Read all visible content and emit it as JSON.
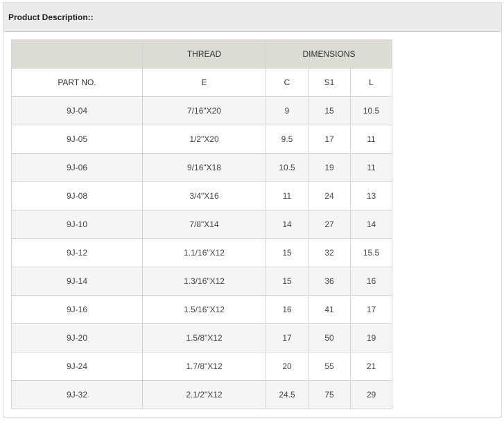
{
  "header": {
    "title": "Product Description::"
  },
  "table": {
    "group_headers": {
      "blank": "",
      "thread": "THREAD",
      "dimensions": "DIMENSIONS"
    },
    "columns": {
      "part_no": "PART NO.",
      "e": "E",
      "c": "C",
      "s1": "S1",
      "l": "L"
    },
    "rows": [
      {
        "part_no": "9J-04",
        "e": "7/16\"X20",
        "c": "9",
        "s1": "15",
        "l": "10.5"
      },
      {
        "part_no": "9J-05",
        "e": "1/2\"X20",
        "c": "9.5",
        "s1": "17",
        "l": "11"
      },
      {
        "part_no": "9J-06",
        "e": "9/16\"X18",
        "c": "10.5",
        "s1": "19",
        "l": "11"
      },
      {
        "part_no": "9J-08",
        "e": "3/4\"X16",
        "c": "11",
        "s1": "24",
        "l": "13"
      },
      {
        "part_no": "9J-10",
        "e": "7/8\"X14",
        "c": "14",
        "s1": "27",
        "l": "14"
      },
      {
        "part_no": "9J-12",
        "e": "1.1/16\"X12",
        "c": "15",
        "s1": "32",
        "l": "15.5"
      },
      {
        "part_no": "9J-14",
        "e": "1.3/16\"X12",
        "c": "15",
        "s1": "36",
        "l": "16"
      },
      {
        "part_no": "9J-16",
        "e": "1.5/16\"X12",
        "c": "16",
        "s1": "41",
        "l": "17"
      },
      {
        "part_no": "9J-20",
        "e": "1.5/8\"X12",
        "c": "17",
        "s1": "50",
        "l": "19"
      },
      {
        "part_no": "9J-24",
        "e": "1.7/8\"X12",
        "c": "20",
        "s1": "55",
        "l": "21"
      },
      {
        "part_no": "9J-32",
        "e": "2.1/2\"X12",
        "c": "24.5",
        "s1": "75",
        "l": "29"
      }
    ]
  }
}
